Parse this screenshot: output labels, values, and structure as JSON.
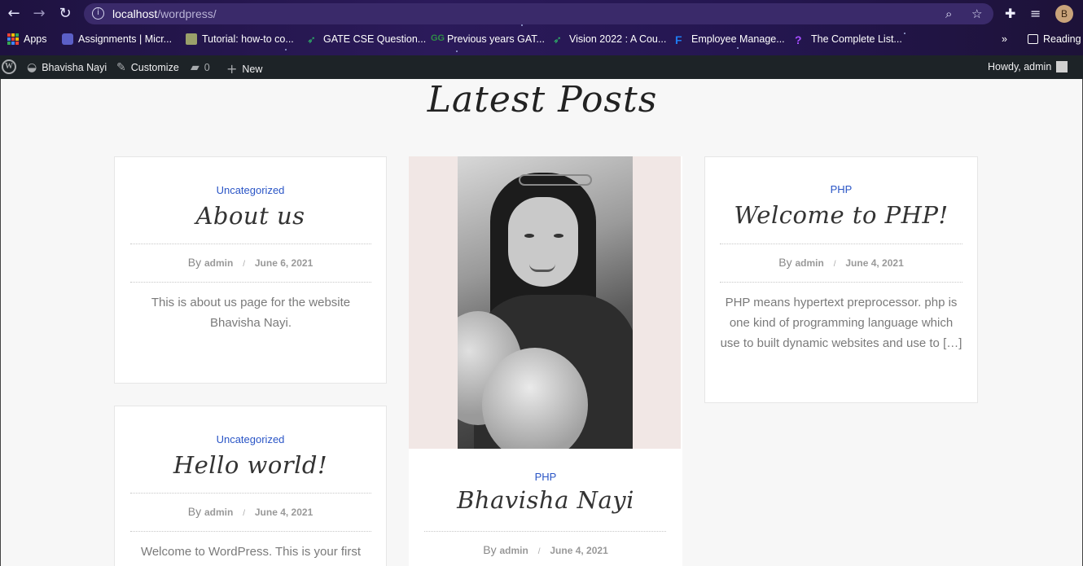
{
  "browser": {
    "url_host": "localhost",
    "url_path": "/wordpress/",
    "profile_initial": "B",
    "bookmarks": [
      {
        "label": "Apps"
      },
      {
        "label": "Assignments | Micr..."
      },
      {
        "label": "Tutorial: how-to co..."
      },
      {
        "label": "GATE CSE Question..."
      },
      {
        "label": "Previous years GAT..."
      },
      {
        "label": "Vision 2022 : A Cou..."
      },
      {
        "label": "Employee Manage..."
      },
      {
        "label": "The Complete List..."
      }
    ],
    "more_label": "»",
    "reading_label": "Reading"
  },
  "adminbar": {
    "site_name": "Bhavisha Nayi",
    "customize": "Customize",
    "comments_count": "0",
    "new_label": "New",
    "howdy": "Howdy, admin"
  },
  "page": {
    "title": "Latest Posts",
    "by_label": "By",
    "sep": "/",
    "posts": [
      {
        "category": "Uncategorized",
        "title": "About us",
        "author": "admin",
        "date": "June 6, 2021",
        "excerpt": "This is about us page for the website Bhavisha Nayi."
      },
      {
        "category": "PHP",
        "title": "Bhavisha Nayi",
        "author": "admin",
        "date": "June 4, 2021"
      },
      {
        "category": "PHP",
        "title": "Welcome to PHP!",
        "author": "admin",
        "date": "June 4, 2021",
        "excerpt": "PHP means hypertext preprocessor. php is one kind of programming language which use to built dynamic websites and use to […]"
      },
      {
        "category": "Uncategorized",
        "title": "Hello world!",
        "author": "admin",
        "date": "June 4, 2021",
        "excerpt": "Welcome to WordPress. This is your first"
      }
    ]
  }
}
